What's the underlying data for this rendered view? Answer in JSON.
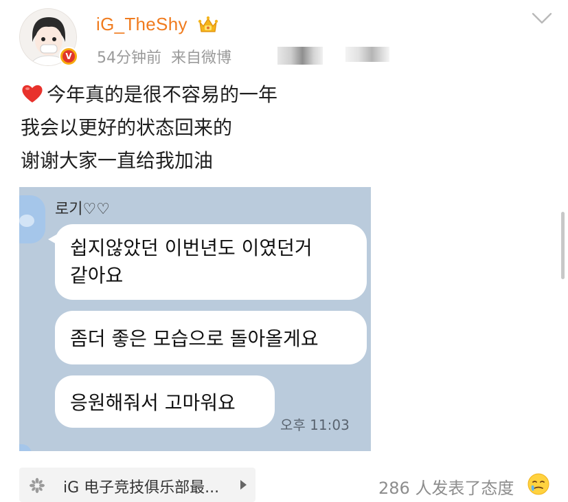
{
  "post": {
    "username": "iG_TheShy",
    "timestamp": "54分钟前",
    "source": "来自微博",
    "text_lines": [
      "今年真的是很不容易的一年",
      "我会以更好的状态回来的",
      "谢谢大家一直给我加油"
    ]
  },
  "chat": {
    "sender": "로기♡♡",
    "messages": [
      "쉽지않았던 이번년도 이였던거\n같아요",
      "좀더 좋은 모습으로 돌아올게요",
      "응원해줘서 고마워요"
    ],
    "time": "오후 11:03"
  },
  "footer": {
    "source_link": "iG 电子竞技俱乐部最...",
    "reactions": "286 人发表了态度"
  },
  "icons": [
    "avatar",
    "verified-v-icon",
    "crown-icon",
    "chevron-down-icon",
    "heart-emoji-icon",
    "pinwheel-icon",
    "play-arrow-icon",
    "react-emoji-icon"
  ],
  "colors": {
    "username": "#f07b1e",
    "meta": "#9a9a9a",
    "chat_bg": "#bacbdc"
  }
}
